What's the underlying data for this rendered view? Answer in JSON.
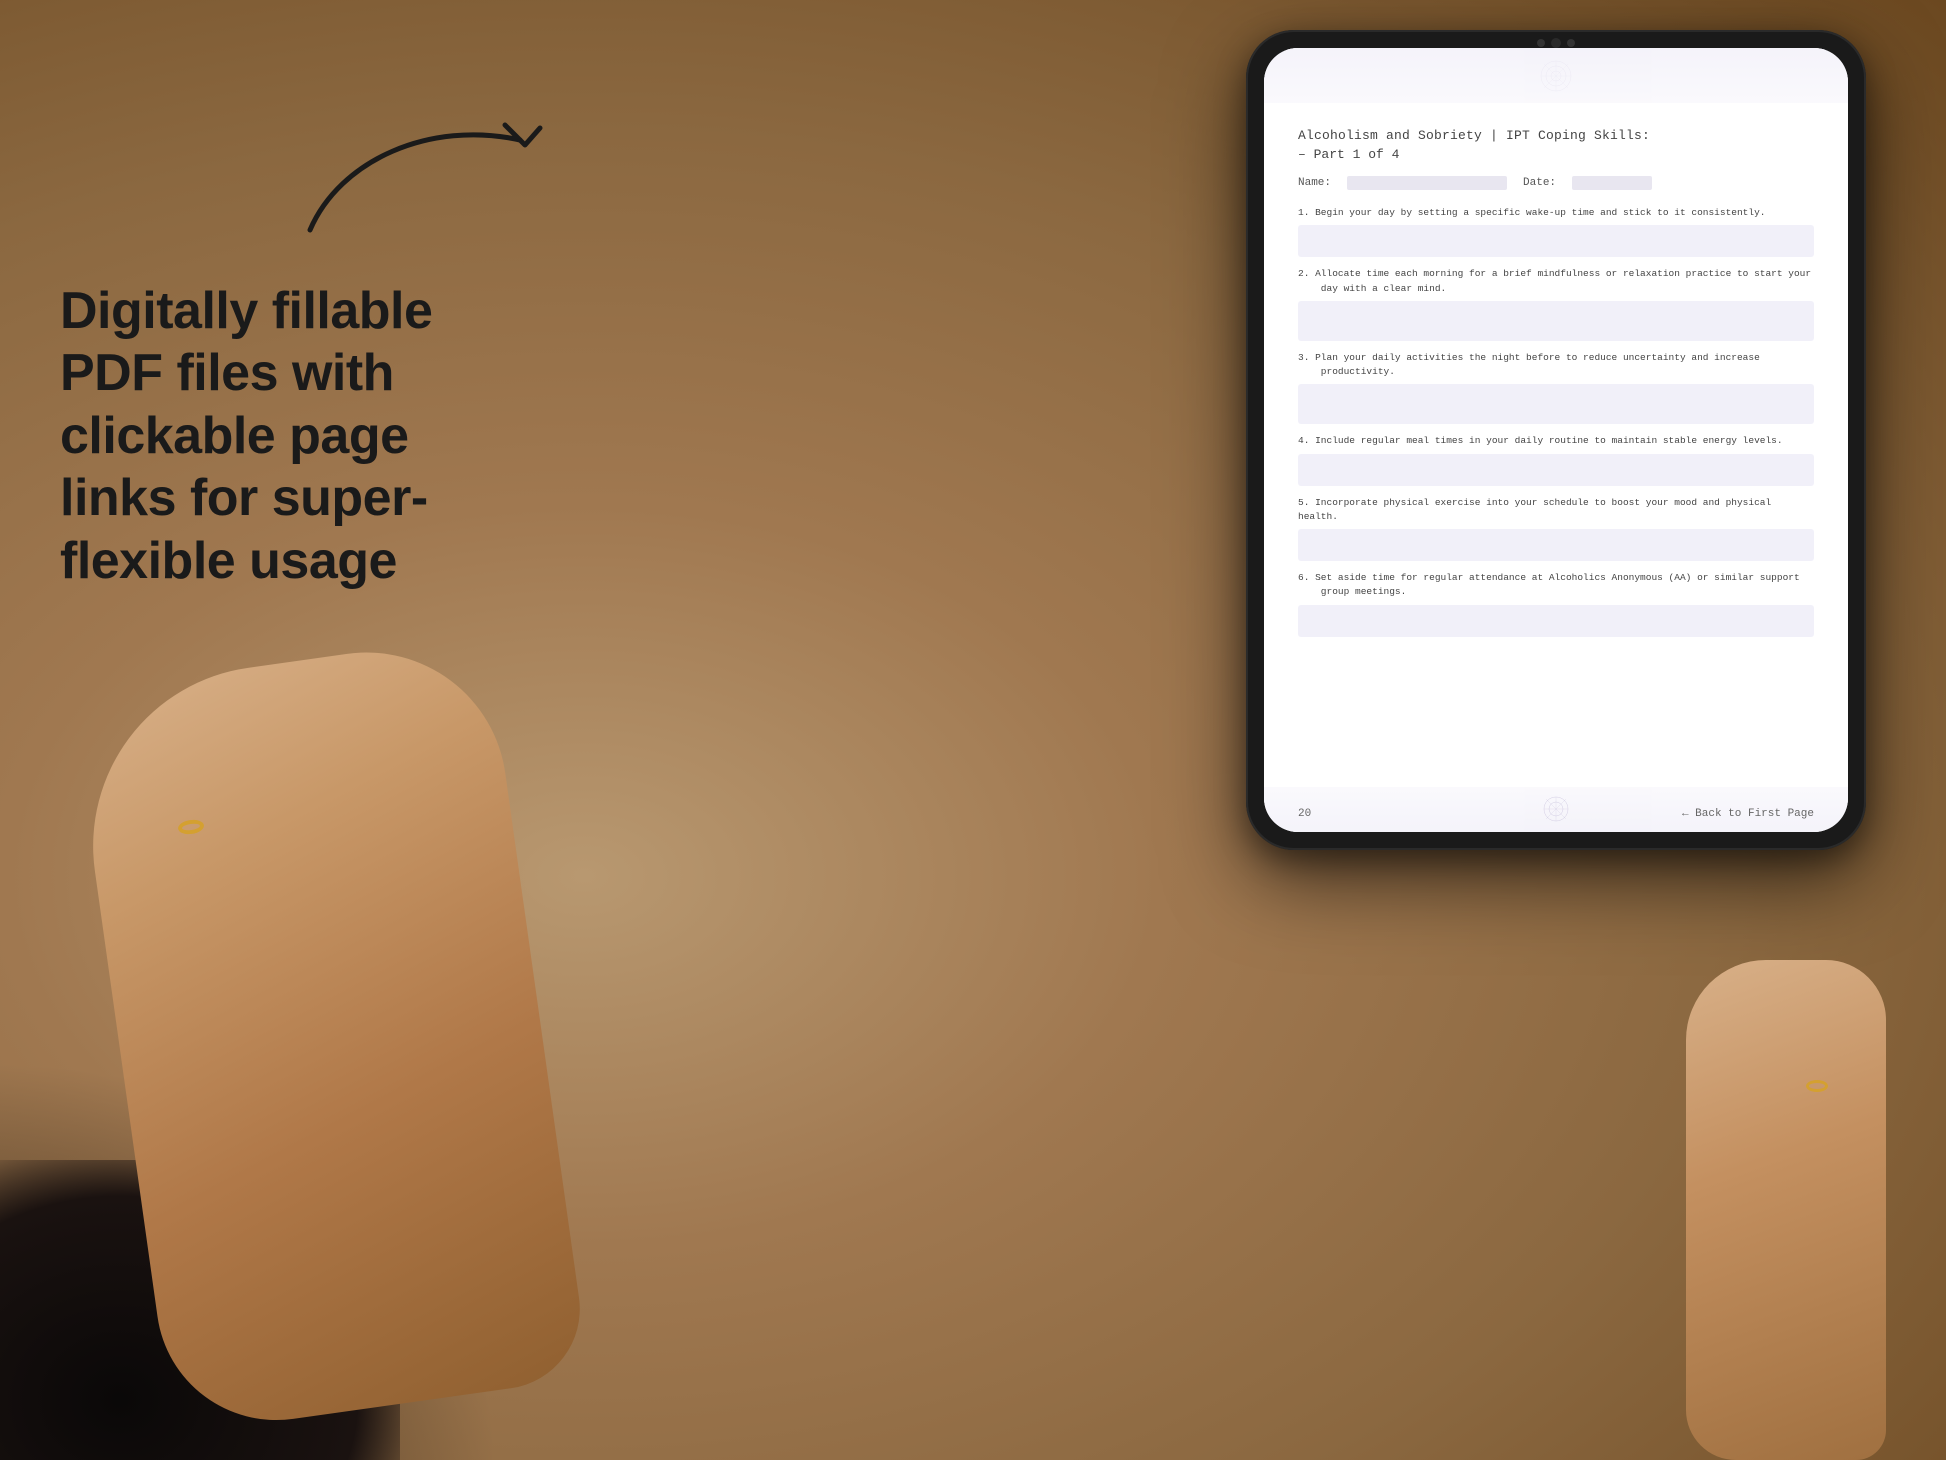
{
  "background": {
    "color": "#c4a882"
  },
  "left_panel": {
    "headline": "Digitally fillable PDF files with clickable page links for super-flexible usage"
  },
  "arrow": {
    "description": "curved arrow pointing right"
  },
  "tablet": {
    "pdf": {
      "title": "Alcoholism and Sobriety | IPT Coping Skills:",
      "subtitle": "– Part 1 of 4",
      "name_label": "Name:",
      "date_label": "Date:",
      "questions": [
        {
          "number": "1.",
          "text": "Begin your day by setting a specific wake-up time and stick to it consistently."
        },
        {
          "number": "2.",
          "text": "Allocate time each morning for a brief mindfulness or relaxation practice to start your day with a clear mind."
        },
        {
          "number": "3.",
          "text": "Plan your daily activities the night before to reduce uncertainty and increase productivity."
        },
        {
          "number": "4.",
          "text": "Include regular meal times in your daily routine to maintain stable energy levels."
        },
        {
          "number": "5.",
          "text": "Incorporate physical exercise into your schedule to boost your mood and physical health."
        },
        {
          "number": "6.",
          "text": "Set aside time for regular attendance at Alcoholics Anonymous (AA) or similar support group meetings."
        }
      ],
      "page_number": "20",
      "back_link": "← Back to First Page"
    }
  }
}
